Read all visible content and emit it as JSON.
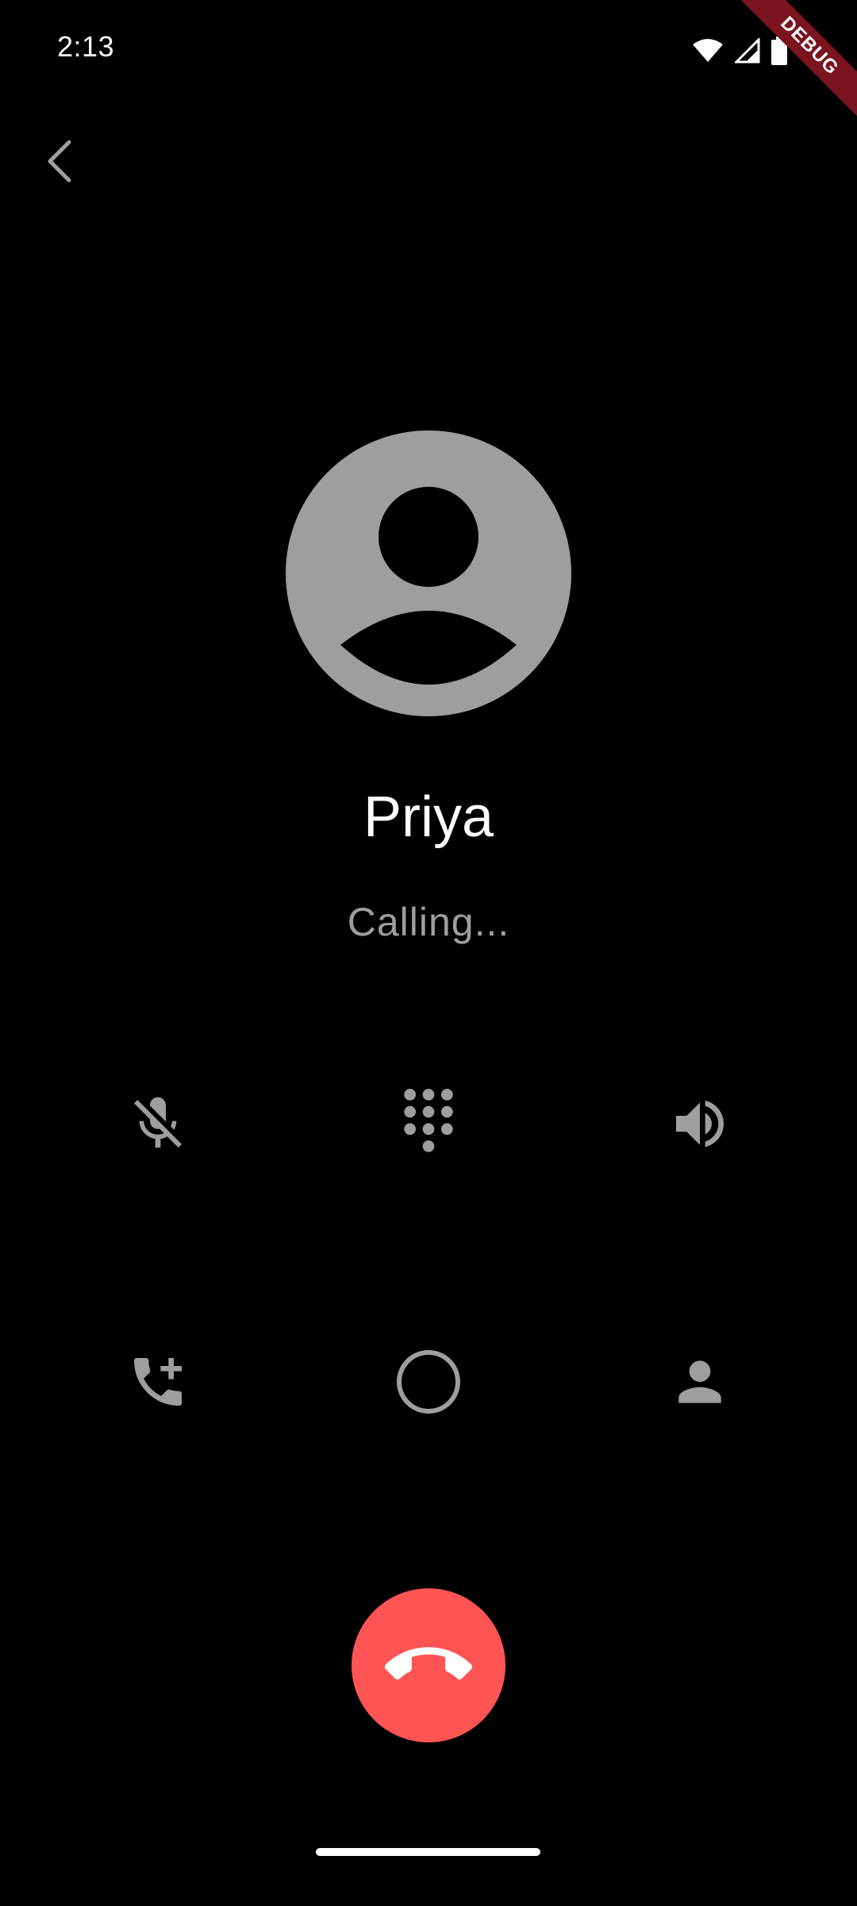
{
  "status_bar": {
    "time": "2:13",
    "icons": [
      "wifi-icon",
      "signal-icon",
      "battery-icon"
    ]
  },
  "debug_banner": {
    "label": "DEBUG"
  },
  "navigation": {
    "back_icon": "chevron-left-icon"
  },
  "call": {
    "contact_name": "Priya",
    "status": "Calling..."
  },
  "controls": [
    {
      "name": "mute",
      "icon": "mic-off-icon"
    },
    {
      "name": "keypad",
      "icon": "dialpad-icon"
    },
    {
      "name": "speaker",
      "icon": "volume-up-icon"
    },
    {
      "name": "add-call",
      "icon": "add-call-icon"
    },
    {
      "name": "hold",
      "icon": "circle-icon"
    },
    {
      "name": "contacts",
      "icon": "person-icon"
    }
  ],
  "end_call": {
    "icon": "call-end-icon"
  },
  "colors": {
    "background": "#000000",
    "icon_gray": "#9e9e9e",
    "end_call_red": "#ff5454",
    "debug_banner": "#7a1420"
  }
}
